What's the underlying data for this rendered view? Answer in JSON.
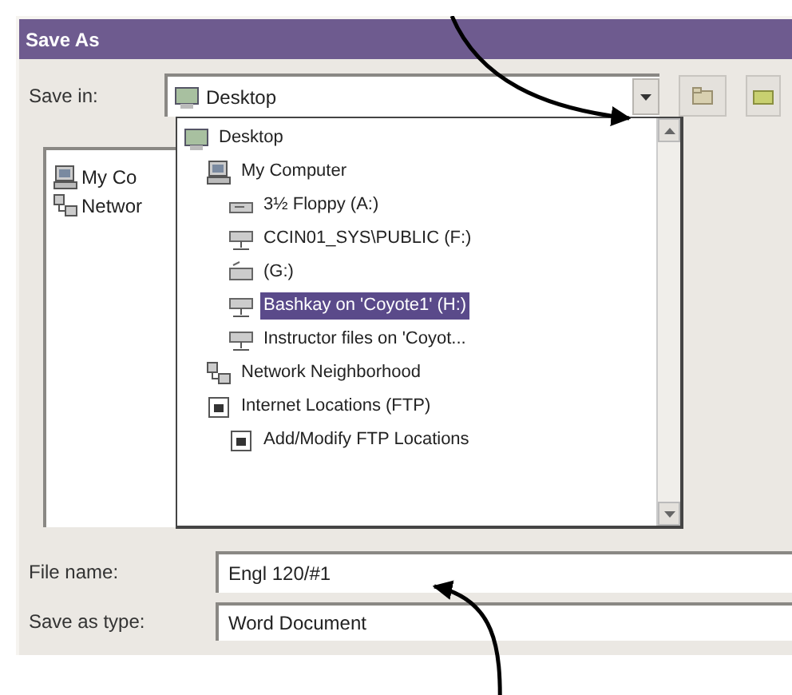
{
  "window": {
    "title": "Save As"
  },
  "save_in": {
    "label": "Save in:",
    "value": "Desktop",
    "kind": "desktop"
  },
  "file_list": [
    {
      "label": "My Co",
      "kind": "computer"
    },
    {
      "label": "Networ",
      "kind": "network"
    }
  ],
  "location_dropdown": {
    "expanded": true,
    "items": [
      {
        "label": "Desktop",
        "kind": "desktop",
        "selected": false,
        "children": [
          {
            "label": "My Computer",
            "kind": "computer",
            "selected": false,
            "children": [
              {
                "label": "3½ Floppy (A:)",
                "kind": "floppy",
                "selected": false
              },
              {
                "label": "CCIN01_SYS\\PUBLIC (F:)",
                "kind": "netdrive",
                "selected": false
              },
              {
                "label": "(G:)",
                "kind": "drive",
                "selected": false
              },
              {
                "label": "Bashkay on 'Coyote1' (H:)",
                "kind": "netdrive",
                "selected": true
              },
              {
                "label": "Instructor files on 'Coyot...",
                "kind": "netdrive",
                "selected": false
              }
            ]
          },
          {
            "label": "Network Neighborhood",
            "kind": "network",
            "selected": false
          },
          {
            "label": "Internet Locations (FTP)",
            "kind": "ftp",
            "selected": false,
            "children": [
              {
                "label": "Add/Modify FTP Locations",
                "kind": "ftp",
                "selected": false
              }
            ]
          }
        ]
      }
    ]
  },
  "file_name": {
    "label": "File name:",
    "value": "Engl 120/#1"
  },
  "save_as_type": {
    "label": "Save as type:",
    "value": "Word Document"
  }
}
